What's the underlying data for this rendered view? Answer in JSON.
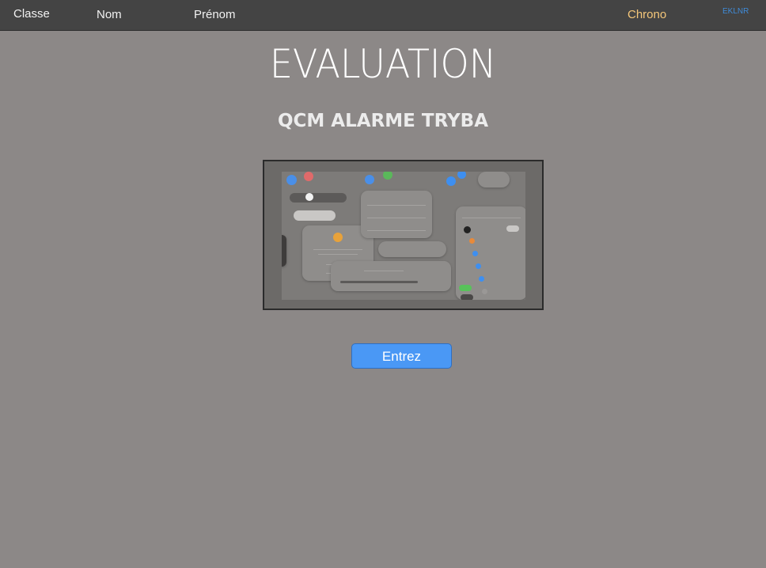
{
  "header": {
    "classe_label": "Classe",
    "nom_label": "Nom",
    "prenom_label": "Prénom",
    "chrono_label": "Chrono",
    "code_label": "EKLNR"
  },
  "main": {
    "title": "EVALUATION",
    "subtitle": "QCM ALARME TRYBA",
    "enter_button": "Entrez"
  },
  "colors": {
    "background": "#8c8887",
    "topbar": "#444444",
    "chrono": "#f5c77a",
    "button": "#4a98f5"
  },
  "icons": {
    "illustration": "control-center-ui-illustration"
  }
}
